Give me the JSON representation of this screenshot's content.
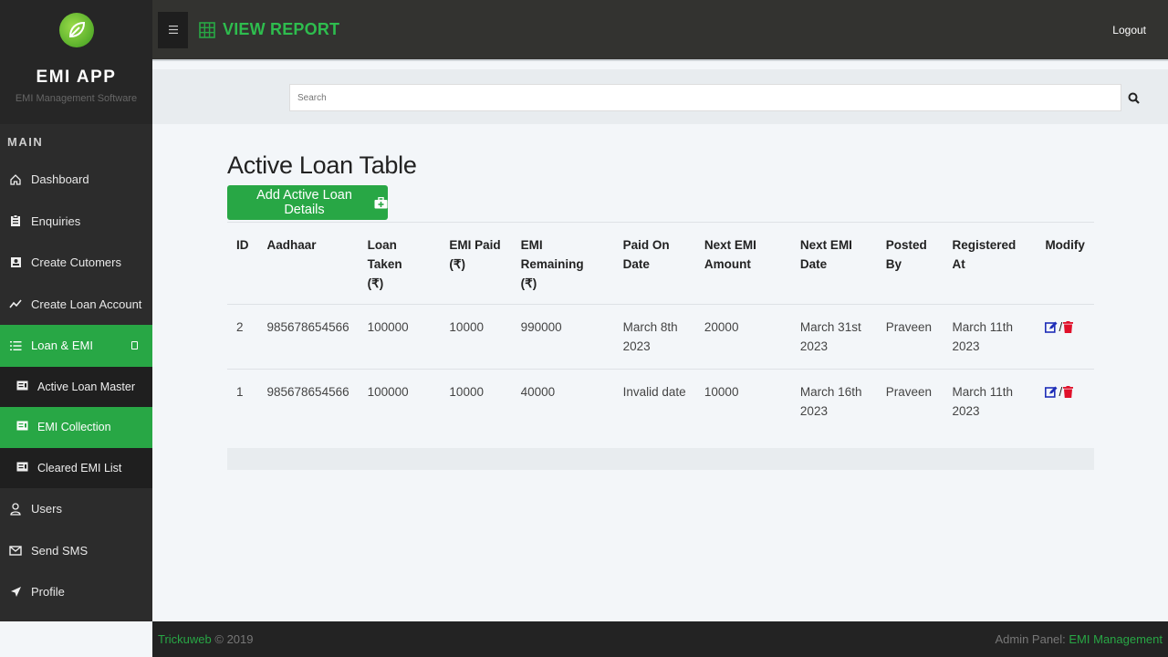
{
  "brand": {
    "title": "EMI APP",
    "subtitle": "EMI Management Software"
  },
  "sidebar": {
    "section": "MAIN",
    "items": [
      {
        "label": "Dashboard",
        "icon": "home-icon"
      },
      {
        "label": "Enquiries",
        "icon": "clipboard-icon"
      },
      {
        "label": "Create Cutomers",
        "icon": "id-card-icon"
      },
      {
        "label": "Create Loan Account",
        "icon": "chart-line-icon"
      },
      {
        "label": "Loan & EMI",
        "icon": "list-icon"
      },
      {
        "label": "Users",
        "icon": "user-icon"
      },
      {
        "label": "Send SMS",
        "icon": "envelope-icon"
      },
      {
        "label": "Profile",
        "icon": "paper-plane-icon"
      }
    ],
    "sub_items": [
      {
        "label": "Active Loan Master"
      },
      {
        "label": "EMI Collection"
      },
      {
        "label": "Cleared EMI List"
      }
    ]
  },
  "topbar": {
    "title": "VIEW REPORT",
    "logout": "Logout"
  },
  "search": {
    "placeholder": "Search"
  },
  "main": {
    "title": "Active Loan Table",
    "add_button": "Add Active Loan Details"
  },
  "table": {
    "headers": [
      [
        "ID"
      ],
      [
        "Aadhaar"
      ],
      [
        "Loan Taken",
        "(₹)"
      ],
      [
        "EMI Paid",
        "(₹)"
      ],
      [
        "EMI Remaining",
        "(₹)"
      ],
      [
        "Paid On",
        "Date"
      ],
      [
        "Next EMI",
        "Amount"
      ],
      [
        "Next EMI",
        "Date"
      ],
      [
        "Posted",
        "By"
      ],
      [
        "Registered At"
      ],
      [
        "Modify"
      ]
    ],
    "rows": [
      {
        "id": "2",
        "aadhaar": "985678654566",
        "loan_taken": "100000",
        "emi_paid": "10000",
        "emi_remaining": "990000",
        "paid_on": [
          "March 8th",
          "2023"
        ],
        "next_amount": "20000",
        "next_date": [
          "March 31st",
          "2023"
        ],
        "posted_by": "Praveen",
        "registered": [
          "March 11th",
          "2023"
        ]
      },
      {
        "id": "1",
        "aadhaar": "985678654566",
        "loan_taken": "100000",
        "emi_paid": "10000",
        "emi_remaining": "40000",
        "paid_on": [
          "Invalid date"
        ],
        "next_amount": "10000",
        "next_date": [
          "March 16th",
          "2023"
        ],
        "posted_by": "Praveen",
        "registered": [
          "March 11th",
          "2023"
        ]
      }
    ],
    "action_separator": "/"
  },
  "footer": {
    "brand": "Trickuweb",
    "copyright": " © 2019",
    "right_prefix": "Admin Panel: ",
    "right_link": "EMI Management"
  },
  "colors": {
    "accent": "#28a745",
    "edit": "#1f2fb8",
    "delete": "#e0102a",
    "sidebar": "#2c2c2c"
  }
}
